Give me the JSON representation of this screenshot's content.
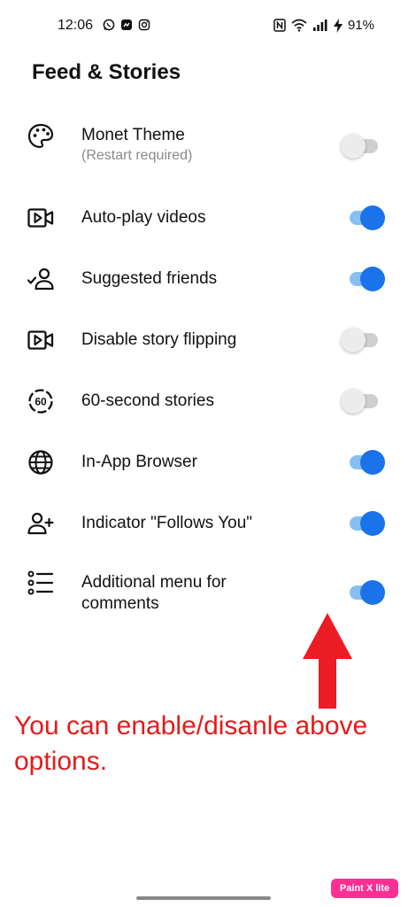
{
  "status_bar": {
    "time": "12:06",
    "left_icons": [
      "whatsapp-icon",
      "messenger-icon",
      "instagram-icon"
    ],
    "right_icons": [
      "nfc-icon",
      "wifi-icon",
      "signal-icon",
      "charging-icon"
    ],
    "battery": "91%"
  },
  "page": {
    "title": "Feed & Stories"
  },
  "settings": [
    {
      "label": "Monet Theme",
      "sublabel": "(Restart required)",
      "icon": "palette-icon",
      "enabled": false
    },
    {
      "label": "Auto-play videos",
      "icon": "video-icon",
      "enabled": true
    },
    {
      "label": "Suggested friends",
      "icon": "user-check-icon",
      "enabled": true
    },
    {
      "label": "Disable story flipping",
      "icon": "video-icon",
      "enabled": false
    },
    {
      "label": "60-second stories",
      "icon": "sixty-seconds-icon",
      "enabled": false
    },
    {
      "label": "In-App Browser",
      "icon": "globe-icon",
      "enabled": true
    },
    {
      "label": "Indicator \"Follows You\"",
      "icon": "user-plus-icon",
      "enabled": true
    },
    {
      "label": "Additional menu for comments",
      "icon": "list-icon",
      "enabled": true
    }
  ],
  "annotation": {
    "text": "You can enable/disanle above options.",
    "color": "#e31b1b"
  },
  "watermark": {
    "text": "Paint X lite"
  },
  "colors": {
    "toggle_on_knob": "#1a73e8",
    "toggle_on_track": "#86c0f3",
    "toggle_off_track": "#cfcfcf"
  }
}
